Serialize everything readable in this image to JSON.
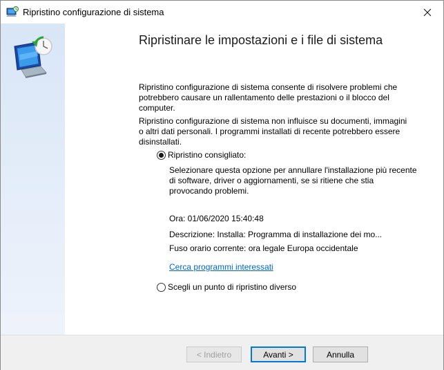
{
  "window": {
    "title": "Ripristino configurazione di sistema",
    "close_glyph": "✕"
  },
  "main": {
    "heading": "Ripristinare le impostazioni e i file di sistema",
    "paragraph1": "Ripristino configurazione di sistema consente di risolvere problemi che potrebbero causare un rallentamento delle prestazioni o il blocco del computer.",
    "paragraph2": "Ripristino configurazione di sistema non influisce su documenti, immagini o altri dati personali. I programmi installati di recente potrebbero essere disinstallati.",
    "option_recommended": {
      "label": "Ripristino consigliato:",
      "selected": true,
      "description": "Selezionare questa opzione per annullare l'installazione più recente di software, driver o aggiornamenti, se si ritiene che stia provocando problemi.",
      "time": "Ora: 01/06/2020 15:40:48",
      "details": "Descrizione: Installa: Programma di installazione dei mo...",
      "timezone": "Fuso orario corrente: ora legale Europa occidentale",
      "link": "Cerca programmi interessati"
    },
    "option_other": {
      "label": "Scegli un punto di ripristino diverso",
      "selected": false
    }
  },
  "footer": {
    "back_label": "< Indietro",
    "next_label": "Avanti >",
    "cancel_label": "Annulla"
  },
  "icons": {
    "title": "system-restore-icon",
    "sidebar": "system-restore-large-icon"
  },
  "colors": {
    "link": "#0066cc",
    "accent": "#0078d7",
    "sidebar": "#d8e6f6"
  }
}
